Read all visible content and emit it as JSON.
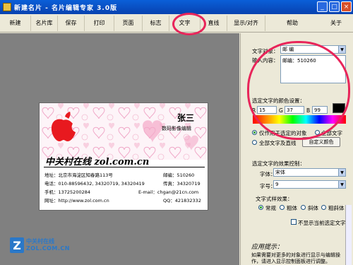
{
  "window": {
    "title": "新建名片 - 名片编辑专家 3.0版"
  },
  "toolbar": {
    "items": [
      "新建",
      "名片库",
      "保存",
      "打印",
      "页面",
      "标志",
      "文字",
      "直线",
      "显示/对齐",
      "帮助",
      "关于"
    ]
  },
  "card": {
    "name": "张三",
    "role": "数码影像编辑",
    "company": "中关村在线  zol.com.cn",
    "address": "地址：北京市海淀区知春路113号",
    "postcode": "邮编：510260",
    "phone": "电话：010-88596432, 34320719, 34320419",
    "fax": "传真：34320719",
    "mobile": "手机：13725200284",
    "email": "E-mail：chgan@21cn.com",
    "website": "网址：http://www.zol.com.cn",
    "qq": "QQ：421832332"
  },
  "watermark": {
    "line1": "中关村在线",
    "line2": "ZOL.COM.CN"
  },
  "panel": {
    "text_object_label": "文字对象：",
    "text_object_value": "邮  编",
    "input_label": "输入内容：",
    "input_value": "邮编：510260",
    "color_section_label": "选定文字的颜色设置：",
    "r_label": "R",
    "r_value": "15",
    "g_label": "G",
    "g_value": "37",
    "b_label": "B",
    "b_value": "99",
    "apply_selected": "仅作用于选定的对象",
    "apply_all": "全部文字",
    "apply_all_lines": "全部文字及直线",
    "custom_color_button": "自定义颜色",
    "effect_section_label": "选定文字的效果控制：",
    "font_label": "字体：",
    "font_value": "宋体",
    "size_label": "字号：",
    "size_value": "9",
    "style_label": "文字式样效果：",
    "style_normal": "常规",
    "style_bold": "粗体",
    "style_italic": "斜体",
    "style_bold_italic": "粗斜体",
    "hide_current": "不显示当前选定文字",
    "hint_title": "应用提示：",
    "hint_text": "如果需要对更多的对象进行显示与编辑操作，请进入显示控制面板进行调整。"
  },
  "colors": {
    "title_bar": "#0842b0",
    "annotation_circle": "#e8255a",
    "apple_logo": "#e8191f",
    "heart_pattern": "#f0a8c8"
  }
}
